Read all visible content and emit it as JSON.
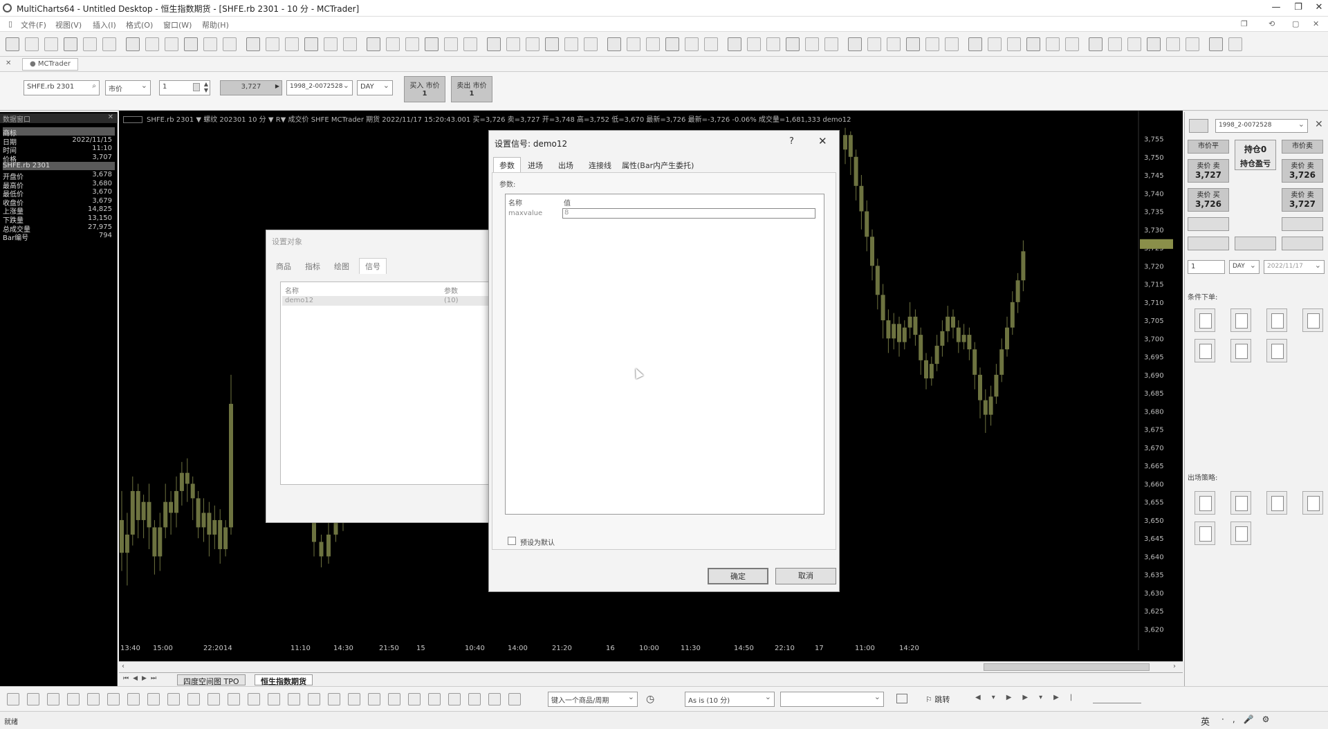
{
  "window": {
    "title": "MultiCharts64 - Untitled Desktop - 恒生指数期货 - [SHFE.rb 2301 - 10 分 - MCTrader]"
  },
  "menu": [
    "文件(F)",
    "视图(V)",
    "插入(I)",
    "格式(O)",
    "窗口(W)",
    "帮助(H)"
  ],
  "tabstrip": {
    "tab": "MCTrader"
  },
  "trade": {
    "symbol": "SHFE.rb 2301",
    "order_type": "市价",
    "qty": "1",
    "price": "3,727",
    "account": "1998_2-0072528",
    "tif": "DAY",
    "buy_label": "买入 市价",
    "buy_qty": "1",
    "sell_label": "卖出 市价",
    "sell_qty": "1"
  },
  "quote": {
    "header": "数据窗口",
    "rows": [
      {
        "label": "商标",
        "value": "",
        "selected": true
      },
      {
        "label": "日期",
        "value": "2022/11/15"
      },
      {
        "label": "时间",
        "value": "11:10"
      },
      {
        "label": "价格",
        "value": "3,707"
      },
      {
        "label": "SHFE.rb 2301",
        "value": "",
        "selected": true
      },
      {
        "label": "开盘价",
        "value": "3,678"
      },
      {
        "label": "最高价",
        "value": "3,680"
      },
      {
        "label": "最低价",
        "value": "3,670"
      },
      {
        "label": "收盘价",
        "value": "3,679"
      },
      {
        "label": "上涨量",
        "value": "14,825"
      },
      {
        "label": "下跌量",
        "value": "13,150"
      },
      {
        "label": "总成交量",
        "value": "27,975"
      },
      {
        "label": "Bar编号",
        "value": "794"
      }
    ]
  },
  "chart_header": "SHFE.rb 2301  ▼  螺纹 202301 10 分  ▼  R▼ 成交价  SHFE  MCTrader  期货  2022/11/17  15:20:43.001  买=3,726  卖=3,727  开=3,748  高=3,752  低=3,670  最新=3,726  最新=-3,726  -0.06%  成交量=1,681,333  demo12",
  "chart_data": {
    "type": "candlestick",
    "y_ticks": [
      "3,755",
      "3,750",
      "3,745",
      "3,740",
      "3,735",
      "3,730",
      "3,725",
      "3,720",
      "3,715",
      "3,710",
      "3,705",
      "3,700",
      "3,695",
      "3,690",
      "3,685",
      "3,680",
      "3,675",
      "3,670",
      "3,665",
      "3,660",
      "3,655",
      "3,650",
      "3,645",
      "3,640",
      "3,635",
      "3,630",
      "3,625",
      "3,620"
    ],
    "ylim": [
      3618,
      3757
    ],
    "x_ticks": [
      "13:40",
      "15:00",
      "22:20",
      "14",
      "11:10",
      "14:30",
      "21:50",
      "15",
      "10:40",
      "14:00",
      "21:20",
      "16",
      "10:00",
      "11:30",
      "14:50",
      "22:10",
      "17",
      "11:00",
      "14:20"
    ],
    "current_price": "3,726",
    "candles_left": [
      [
        3650,
        3641,
        3658,
        3636
      ],
      [
        3641,
        3646,
        3652,
        3632
      ],
      [
        3646,
        3658,
        3662,
        3643
      ],
      [
        3658,
        3650,
        3660,
        3645
      ],
      [
        3650,
        3655,
        3657,
        3645
      ],
      [
        3655,
        3648,
        3660,
        3642
      ],
      [
        3648,
        3640,
        3650,
        3635
      ],
      [
        3640,
        3648,
        3652,
        3636
      ],
      [
        3648,
        3655,
        3660,
        3645
      ],
      [
        3655,
        3652,
        3658,
        3646
      ],
      [
        3652,
        3658,
        3662,
        3648
      ],
      [
        3658,
        3663,
        3666,
        3654
      ],
      [
        3663,
        3660,
        3667,
        3655
      ],
      [
        3660,
        3656,
        3662,
        3650
      ],
      [
        3656,
        3648,
        3658,
        3645
      ],
      [
        3648,
        3652,
        3656,
        3644
      ],
      [
        3652,
        3646,
        3655,
        3640
      ],
      [
        3646,
        3650,
        3654,
        3642
      ],
      [
        3650,
        3642,
        3653,
        3638
      ],
      [
        3642,
        3648,
        3650,
        3640
      ],
      [
        3648,
        3682,
        3690,
        3646
      ]
    ],
    "candles_mid": [
      [
        3650,
        3644,
        3652,
        3640
      ],
      [
        3644,
        3640,
        3646,
        3637
      ],
      [
        3640,
        3646,
        3650,
        3638
      ],
      [
        3646,
        3652,
        3656,
        3644
      ],
      [
        3652,
        3650,
        3655,
        3647
      ]
    ],
    "candles_right": [
      [
        3752,
        3756,
        3758,
        3748
      ],
      [
        3756,
        3750,
        3757,
        3745
      ],
      [
        3750,
        3742,
        3752,
        3738
      ],
      [
        3742,
        3735,
        3745,
        3730
      ],
      [
        3735,
        3728,
        3738,
        3724
      ],
      [
        3728,
        3720,
        3730,
        3716
      ],
      [
        3720,
        3712,
        3722,
        3708
      ],
      [
        3712,
        3705,
        3715,
        3700
      ],
      [
        3705,
        3700,
        3708,
        3696
      ],
      [
        3700,
        3704,
        3707,
        3697
      ],
      [
        3704,
        3699,
        3706,
        3695
      ],
      [
        3699,
        3703,
        3705,
        3697
      ],
      [
        3703,
        3706,
        3710,
        3700
      ],
      [
        3706,
        3701,
        3708,
        3698
      ],
      [
        3701,
        3694,
        3703,
        3690
      ],
      [
        3694,
        3689,
        3696,
        3686
      ],
      [
        3689,
        3693,
        3695,
        3687
      ],
      [
        3693,
        3698,
        3701,
        3691
      ],
      [
        3698,
        3702,
        3705,
        3695
      ],
      [
        3702,
        3706,
        3709,
        3699
      ],
      [
        3706,
        3703,
        3708,
        3700
      ],
      [
        3703,
        3699,
        3705,
        3696
      ],
      [
        3699,
        3701,
        3704,
        3697
      ],
      [
        3701,
        3697,
        3703,
        3694
      ],
      [
        3697,
        3690,
        3699,
        3686
      ],
      [
        3690,
        3683,
        3692,
        3678
      ],
      [
        3683,
        3679,
        3686,
        3674
      ],
      [
        3679,
        3684,
        3687,
        3676
      ],
      [
        3684,
        3690,
        3693,
        3682
      ],
      [
        3690,
        3697,
        3700,
        3688
      ],
      [
        3697,
        3703,
        3706,
        3695
      ],
      [
        3703,
        3710,
        3713,
        3701
      ],
      [
        3710,
        3716,
        3718,
        3707
      ],
      [
        3716,
        3724,
        3727,
        3713
      ]
    ]
  },
  "dialog_object": {
    "title": "设置对象",
    "tabs": [
      "商品",
      "指标",
      "绘图",
      "信号"
    ],
    "col_name": "名称",
    "col_param": "参数",
    "row_name": "demo12",
    "row_param": "(10)"
  },
  "dialog_signal": {
    "title": "设置信号:  demo12",
    "help": "?",
    "close": "✕",
    "tabs": [
      "参数",
      "进场",
      "出场",
      "连接线",
      "属性(Bar内产生委托)"
    ],
    "section": "参数:",
    "col_name": "名称",
    "col_value": "值",
    "param_name": "maxvalue",
    "param_value": "8",
    "checkbox_label": "预设为默认",
    "ok": "确定",
    "cancel": "取消"
  },
  "right": {
    "account": "1998_2-0072528",
    "btn_flat": "市价平",
    "position": "持仓0",
    "pnl": "持仓盈亏",
    "btn_sell_mkt": "市价卖",
    "bid_label": "卖价 卖",
    "bid": "3,727",
    "ask_label": "卖价 卖",
    "ask": "3,726",
    "buy_label": "卖价 买",
    "buy": "3,726",
    "sell2_label": "卖价 卖",
    "sell2": "3,727",
    "qty": "1",
    "tif": "DAY",
    "date": "2022/11/17",
    "cond_title": "条件下单:",
    "exit_title": "出场策略:"
  },
  "sheets": [
    "四度空间图 TPO",
    "恒生指数期货"
  ],
  "drawbar": {
    "symbol_input": "键入一个商品/周期",
    "resolution": "As is (10 分)",
    "jump": "跳转"
  },
  "status": {
    "text": "就绪",
    "ime": "英"
  }
}
